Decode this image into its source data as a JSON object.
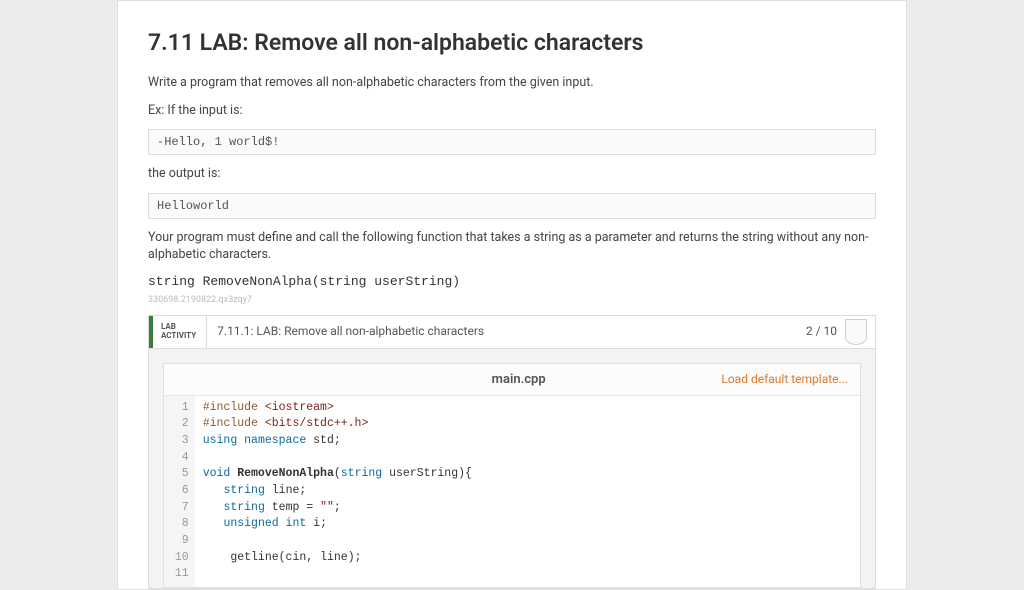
{
  "page": {
    "title": "7.11 LAB: Remove all non-alphabetic characters",
    "prompt": "Write a program that removes all non-alphabetic characters from the given input.",
    "ex_input_label": "Ex: If the input is:",
    "ex_input": "-Hello, 1 world$!",
    "ex_output_label": "the output is:",
    "ex_output": "Helloworld",
    "req_text": "Your program must define and call the following function that takes a string as a parameter and returns the string without any non-alphabetic characters.",
    "signature": "string RemoveNonAlpha(string userString)",
    "small_id": "330698.2190822.qx3zqy7"
  },
  "activity": {
    "tag1": "LAB",
    "tag2": "ACTIVITY",
    "title": "7.11.1: LAB: Remove all non-alphabetic characters",
    "score": "2 / 10"
  },
  "editor": {
    "filename": "main.cpp",
    "load_template": "Load default template...",
    "code": {
      "l1": {
        "pp": "#include",
        "rest": " <iostream>"
      },
      "l2": {
        "pp": "#include",
        "rest": " <bits/stdc++.h>"
      },
      "l3": {
        "kw": "using",
        "ns": " namespace ",
        "id": "std",
        "tail": ";"
      },
      "l5_void": "void",
      "l5_fn": " RemoveNonAlpha",
      "l5_sig_open": "(",
      "l5_ty": "string",
      "l5_arg": " userString",
      "l5_sig_close": "){",
      "l6_ty": "string",
      "l6_rest": " line;",
      "l7_ty": "string",
      "l7_var": " temp ",
      "l7_eq": "=",
      "l7_str": " \"\"",
      "l7_tail": ";",
      "l8_ty": "unsigned int",
      "l8_rest": " i;",
      "l10_fn": "getline",
      "l10_open": "(",
      "l10_a": "cin",
      "l10_c": ", ",
      "l10_b": "line",
      "l10_close": ");"
    },
    "line_numbers": "  1\n  2\n  3\n  4\n  5\n  6\n  7\n  8\n  9\n 10\n 11"
  }
}
